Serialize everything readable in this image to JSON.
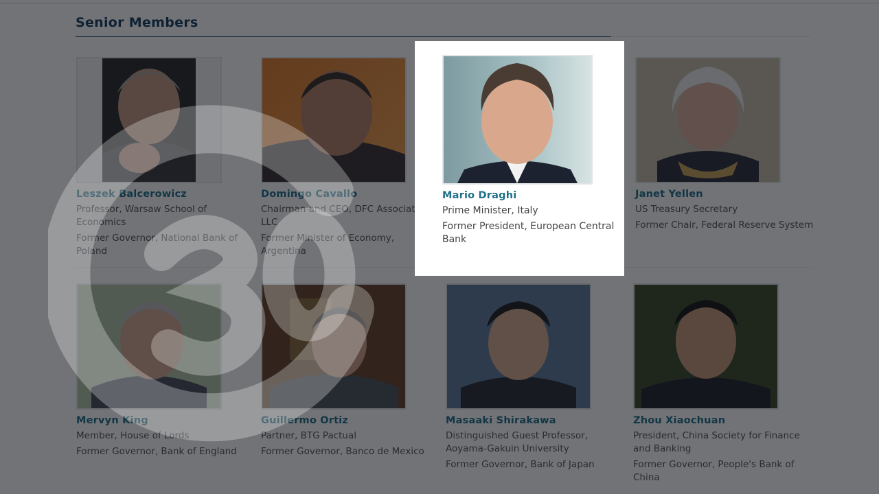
{
  "section": {
    "title": "Senior Members"
  },
  "members": [
    {
      "name": "Leszek Balcerowicz",
      "line1": "Professor, Warsaw School of Economics",
      "line2": "Former Governor, National Bank of Poland"
    },
    {
      "name": "Domingo Cavallo",
      "line1": "Chairman and CEO, DFC Associates, LLC",
      "line2": "Former Minister of Economy, Argentina"
    },
    {
      "name": "Mario Draghi",
      "line1": "Prime Minister, Italy",
      "line2": "Former President, European Central Bank"
    },
    {
      "name": "Janet Yellen",
      "line1": "US Treasury Secretary",
      "line2": "Former Chair, Federal Reserve System"
    },
    {
      "name": "Mervyn King",
      "line1": "Member, House of Lords",
      "line2": "Former Governor, Bank of England"
    },
    {
      "name": "Guillermo Ortiz",
      "line1": "Partner, BTG Pactual",
      "line2": "Former Governor, Banco de Mexico"
    },
    {
      "name": "Masaaki Shirakawa",
      "line1": "Distinguished Guest Professor, Aoyama-Gakuin University",
      "line2": "Former Governor, Bank of Japan"
    },
    {
      "name": "Zhou Xiaochuan",
      "line1": "President, China Society for Finance and Banking",
      "line2": "Former Governor, People's Bank of China"
    }
  ],
  "watermark": {
    "text": "G30"
  },
  "colors": {
    "name": "#1f6f88",
    "heading": "#143b5b",
    "overlay": "#0a0e14"
  }
}
